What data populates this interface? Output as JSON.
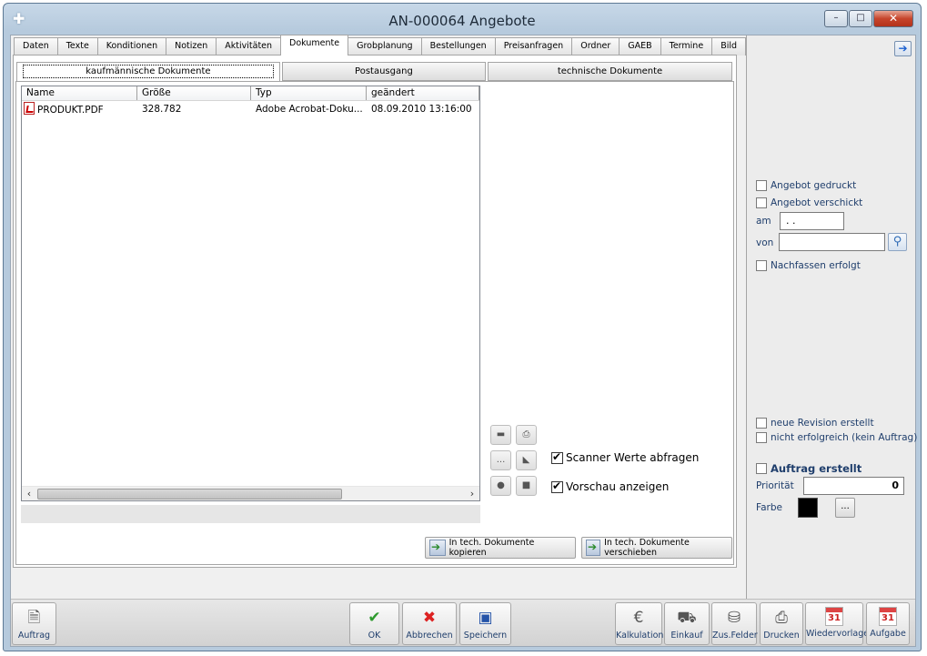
{
  "window": {
    "title": "AN-000064 Angebote",
    "controls": {
      "minimize": "–",
      "maximize": "□",
      "close": "✕"
    }
  },
  "tabs": [
    {
      "label": "Daten"
    },
    {
      "label": "Texte"
    },
    {
      "label": "Konditionen"
    },
    {
      "label": "Notizen"
    },
    {
      "label": "Aktivitäten"
    },
    {
      "label": "Dokumente",
      "active": true
    },
    {
      "label": "Grobplanung"
    },
    {
      "label": "Bestellungen"
    },
    {
      "label": "Preisanfragen"
    },
    {
      "label": "Ordner"
    },
    {
      "label": "GAEB"
    },
    {
      "label": "Termine"
    },
    {
      "label": "Bild"
    }
  ],
  "subtabs": [
    {
      "label": "kaufmännische Dokumente",
      "active": true
    },
    {
      "label": "Postausgang"
    },
    {
      "label": "technische Dokumente"
    }
  ],
  "filelist": {
    "columns": [
      "Name",
      "Größe",
      "Typ",
      "geändert"
    ],
    "rows": [
      {
        "name": "PRODUKT.PDF",
        "size": "328.782",
        "type": "Adobe Acrobat-Doku...",
        "modified": "08.09.2010 13:16:00"
      }
    ]
  },
  "options": {
    "scanner_label": "Scanner Werte abfragen",
    "scanner_checked": true,
    "preview_label": "Vorschau anzeigen",
    "preview_checked": true
  },
  "small_tools": {
    "browse_label": "..."
  },
  "actions": {
    "copy_label": "In tech. Dokumente kopieren",
    "move_label": "In tech. Dokumente verschieben"
  },
  "right_panel": {
    "angebot_gedruckt": {
      "label": "Angebot gedruckt",
      "checked": false
    },
    "angebot_verschickt": {
      "label": "Angebot verschickt",
      "checked": false
    },
    "am_label": "am",
    "am_value": " . .",
    "von_label": "von",
    "von_value": "",
    "nachfassen": {
      "label": "Nachfassen erfolgt",
      "checked": false
    },
    "neue_revision": {
      "label": "neue Revision erstellt",
      "checked": false
    },
    "nicht_erfolgreich": {
      "label": "nicht erfolgreich (kein Auftrag)",
      "checked": false
    },
    "auftrag_erstellt": {
      "label": "Auftrag erstellt",
      "checked": false
    },
    "prioritaet_label": "Priorität",
    "prioritaet_value": "0",
    "farbe_label": "Farbe",
    "farbe_value": "#000000",
    "farbe_button": "..."
  },
  "bottom_toolbar": {
    "auftrag": "Auftrag",
    "ok": "OK",
    "abbrechen": "Abbrechen",
    "speichern": "Speichern",
    "kalkulation": "Kalkulation",
    "einkauf": "Einkauf",
    "zus_felder": "Zus.Felder",
    "drucken": "Drucken",
    "wiedervorlage": "Wiedervorlage",
    "aufgabe": "Aufgabe",
    "calendar_day": "31"
  },
  "colors": {
    "title_bar": "#b6cadd",
    "accent_blue": "#1f3e6c",
    "ok_green": "#2e9a2e",
    "cancel_red": "#dd2222"
  }
}
